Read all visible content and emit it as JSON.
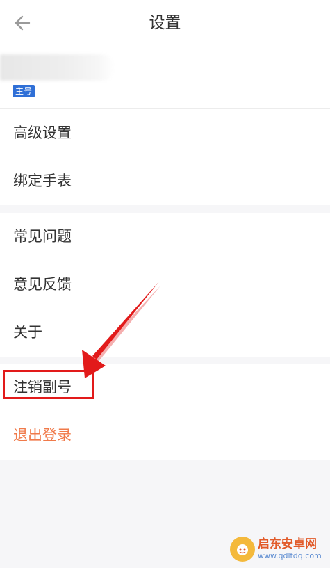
{
  "header": {
    "title": "设置",
    "back_icon": "arrow-left-icon"
  },
  "account": {
    "badge": "主号"
  },
  "menu": {
    "section1": [
      "高级设置",
      "绑定手表"
    ],
    "section2": [
      "常见问题",
      "意见反馈",
      "关于"
    ],
    "section3": {
      "cancel_sub_account": "注销副号",
      "logout": "退出登录"
    }
  },
  "colors": {
    "logout": "#f07a4a",
    "badge": "#2f6fd6",
    "annotation": "#e21a1a"
  },
  "watermark": {
    "name": "启东安卓网",
    "url": "www.qdltdq.com"
  }
}
